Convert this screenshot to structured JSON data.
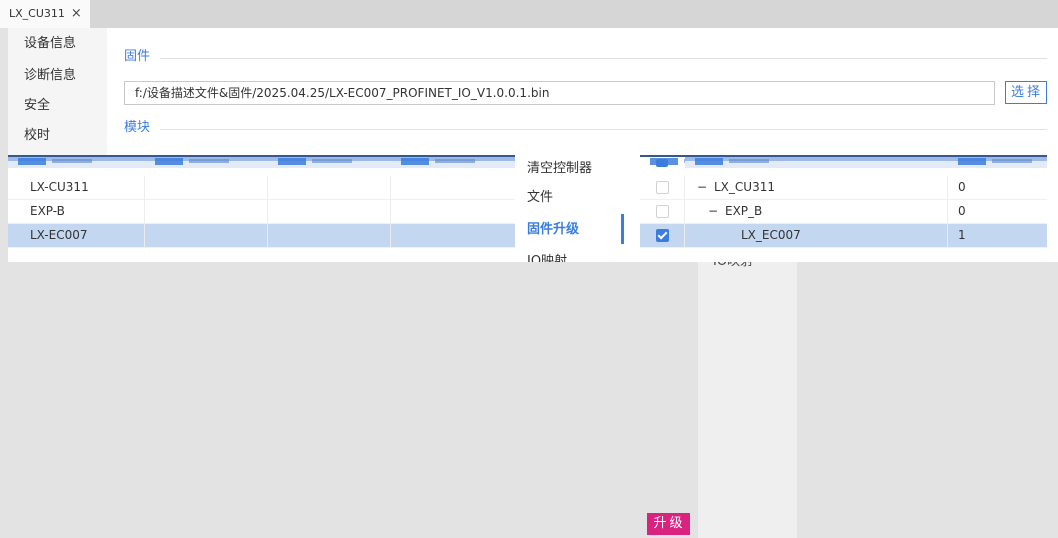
{
  "tabs": [
    {
      "label": "LX_CU311",
      "close": "×"
    }
  ],
  "sidebar": {
    "items": [
      {
        "label": "设备信息"
      },
      {
        "label": "诊断信息"
      },
      {
        "label": "安全"
      },
      {
        "label": "校时"
      }
    ]
  },
  "firmware": {
    "section_label": "固件",
    "path_value": "f:/设备描述文件&固件/2025.04.25/LX-EC007_PROFINET_IO_V1.0.0.1.bin",
    "select_label": "选择"
  },
  "modules": {
    "section_label": "模块",
    "rows": [
      {
        "model": "LX-CU311",
        "selected": false
      },
      {
        "model": "EXP-B",
        "selected": false
      },
      {
        "model": "LX-EC007",
        "selected": true
      }
    ]
  },
  "menu": {
    "items": [
      {
        "label": "清空控制器",
        "active": false
      },
      {
        "label": "文件",
        "active": false
      },
      {
        "label": "固件升级",
        "active": true
      },
      {
        "label": "IO映射",
        "active": false
      }
    ]
  },
  "tree": {
    "rows": [
      {
        "toggle": "−",
        "name": "LX_CU311",
        "value": "0",
        "checked": false,
        "selected": false
      },
      {
        "toggle": "−",
        "name": "EXP_B",
        "value": "0",
        "checked": false,
        "selected": false
      },
      {
        "name": "LX_EC007",
        "value": "1",
        "checked": true,
        "selected": true
      }
    ]
  },
  "background_panel": {
    "label": "IO映射"
  },
  "upgrade_button": {
    "label": "升级"
  },
  "icons": {
    "tab_close": "close-icon",
    "checkbox": "checkbox-icon",
    "tree_toggle": "collapse-icon"
  },
  "colors": {
    "accent": "#3b7ddd",
    "upgrade": "#d9237f",
    "selected_row": "#c3d7f1",
    "backdrop": "#e3e3e3"
  }
}
